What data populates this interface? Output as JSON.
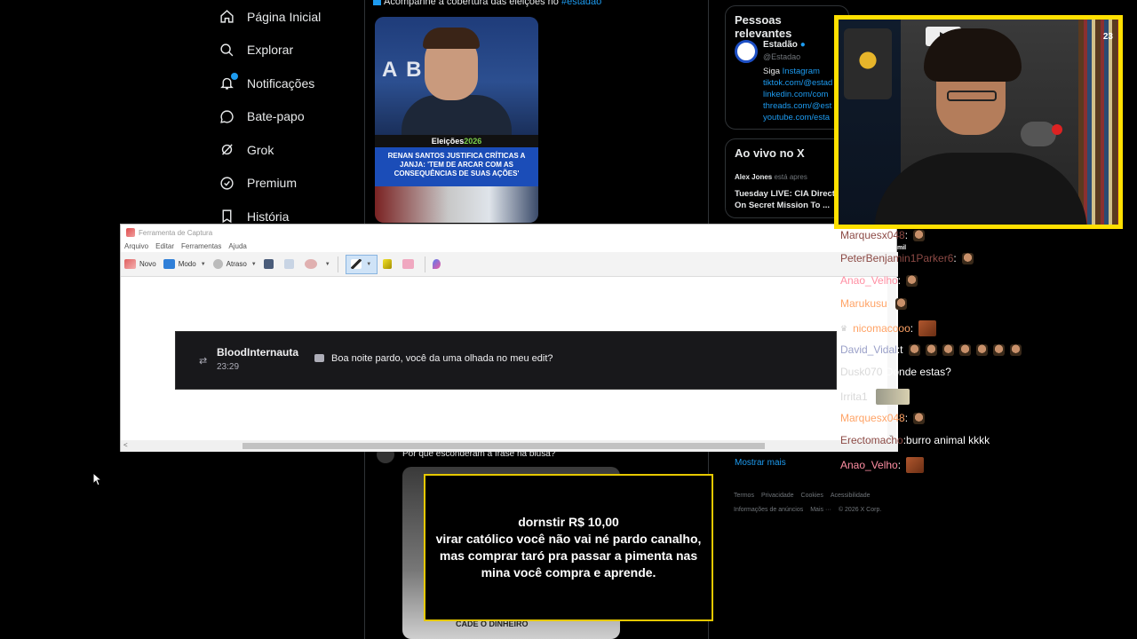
{
  "x_nav": {
    "items": [
      {
        "label": "Página Inicial",
        "icon": "home-icon"
      },
      {
        "label": "Explorar",
        "icon": "search-icon"
      },
      {
        "label": "Notificações",
        "icon": "bell-icon"
      },
      {
        "label": "Bate-papo",
        "icon": "chat-icon"
      },
      {
        "label": "Grok",
        "icon": "grok-icon"
      },
      {
        "label": "Premium",
        "icon": "premium-icon"
      },
      {
        "label": "História",
        "icon": "bookmark-icon"
      }
    ]
  },
  "feed": {
    "top_text": "Acompanhe a cobertura das eleições no ",
    "top_hashtag": "#estadão",
    "news_tag_prefix": "Eleições",
    "news_tag_year": "2026",
    "news_headline": "RENAN SANTOS JUSTIFICA CRÍTICAS A JANJA: 'TEM DE ARCAR COM AS CONSEQUÊNCIAS DE SUAS AÇÕES'",
    "photo_text": "A  B F",
    "mid_text": "Por que esconderam a frase na blusa?",
    "shirt_text": "CADÊ O DINHEIRO"
  },
  "right": {
    "pessoas_title": "Pessoas relevantes",
    "estadao_name": "Estadão",
    "estadao_handle": "@Estadao",
    "estadao_bio_lead": "Siga ",
    "estadao_bio_link1": "Instagram",
    "estadao_bio_lines": [
      "tiktok.com/@estad",
      "linkedin.com/com",
      "threads.com/@est",
      "youtube.com/esta"
    ],
    "aovivo_title": "Ao vivo no X",
    "live_user": "Alex Jones",
    "live_status": " está apres",
    "live_title_1": "Tuesday LIVE: CIA Direct",
    "live_title_2": "On Secret Mission To ...",
    "mostrar_mais": "Mostrar mais",
    "footer_links": [
      "Termos",
      "Privacidade",
      "Cookies",
      "Acessibilidade"
    ],
    "footer_links2": [
      "Informações de anúncios",
      "Mais ···",
      "© 2026 X Corp."
    ]
  },
  "snip": {
    "title": "Ferramenta de Captura",
    "menu": [
      "Arquivo",
      "Editar",
      "Ferramentas",
      "Ajuda"
    ],
    "new_label": "Novo",
    "mode_label": "Modo",
    "delay_label": "Atraso",
    "chat_user": "BloodInternauta",
    "chat_time": "23:29",
    "chat_message": "Boa noite pardo, você da uma olhada no meu edit?"
  },
  "webcam": {
    "badge": "23"
  },
  "twitch_chat": {
    "mil_label": "mil",
    "lines": [
      {
        "user": "Marquesx048",
        "sep": " : ",
        "msg": ""
      },
      {
        "user": "PeterBenjamin1Parker6",
        "sep": " : ",
        "msg": ""
      },
      {
        "user": "Anao_Velho",
        "sep": " : ",
        "msg": ""
      },
      {
        "user": "Marukusu",
        "sep": " : ",
        "msg": ""
      },
      {
        "user": "nicomacooo",
        "sep": " : ",
        "msg": ""
      },
      {
        "user": "David_Vidal",
        "sep": " : ",
        "msg": "t"
      },
      {
        "user": "Dusk070",
        "sep": " : ",
        "msg": "Donde estas?"
      },
      {
        "user": "Irrita1",
        "sep": " : ",
        "msg": ""
      },
      {
        "user": "Marquesx048",
        "sep": " : ",
        "msg": ""
      },
      {
        "user": "Erectomacho",
        "sep": " : ",
        "msg": "burro animal kkkk"
      },
      {
        "user": "Anao_Velho",
        "sep": " : ",
        "msg": ""
      }
    ]
  },
  "donation": {
    "line1": "dornstir R$ 10,00",
    "line2": "virar católico você não vai né pardo canalho,",
    "line3": "mas comprar taró pra passar a pimenta nas",
    "line4": "mina você compra e aprende."
  },
  "colors": {
    "x_blue": "#1d9bf0",
    "webcam_border": "#ffe000",
    "donation_border": "#e6c800"
  }
}
